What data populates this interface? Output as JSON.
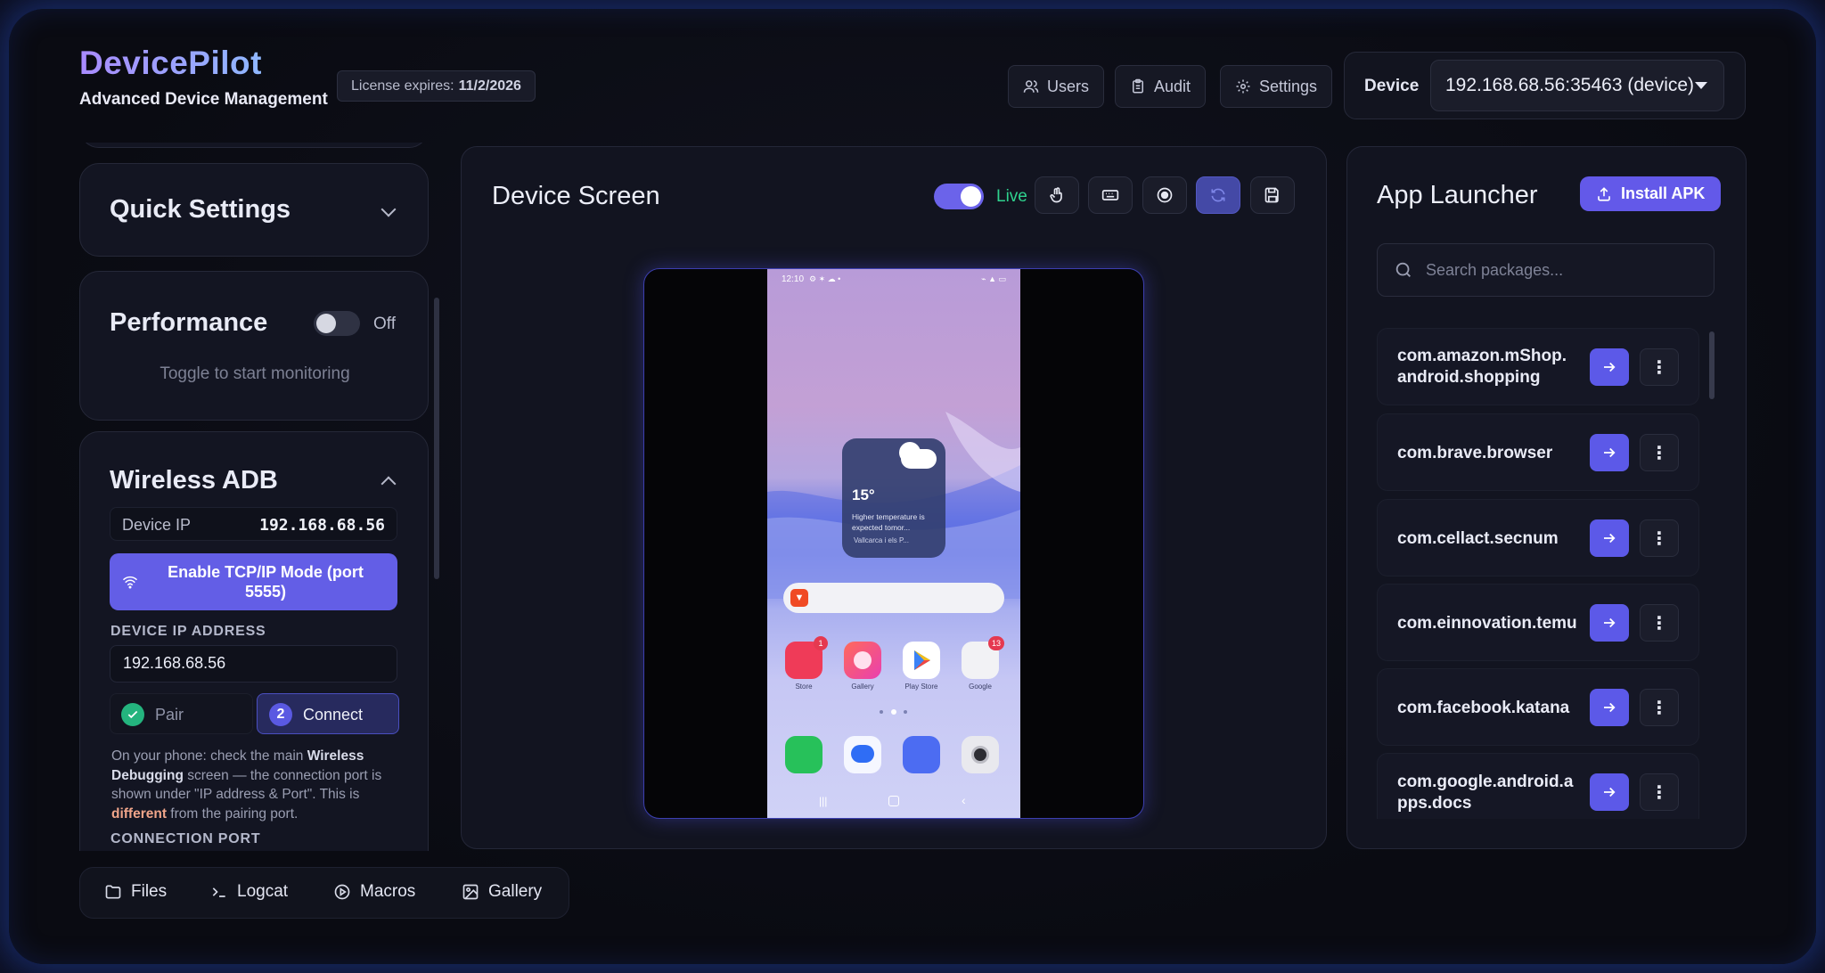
{
  "brand": {
    "title": "DevicePilot",
    "subtitle": "Advanced Device Management"
  },
  "license": {
    "label": "License expires:",
    "date": "11/2/2026"
  },
  "header_nav": {
    "users": "Users",
    "audit": "Audit",
    "settings": "Settings"
  },
  "device": {
    "label": "Device",
    "selected": "192.168.68.56:35463 (device)"
  },
  "quick_settings": {
    "title": "Quick Settings"
  },
  "performance": {
    "title": "Performance",
    "toggle_state": "Off",
    "hint": "Toggle to start monitoring"
  },
  "wireless_adb": {
    "title": "Wireless ADB",
    "device_ip_label": "Device IP",
    "device_ip_value": "192.168.68.56",
    "enable_button": "Enable TCP/IP Mode (port 5555)",
    "ip_address_heading": "DEVICE IP ADDRESS",
    "ip_address_value": "192.168.68.56",
    "step1_label": "Pair",
    "step2_number": "2",
    "step2_label": "Connect",
    "help_p1": "On your phone: check the main ",
    "help_b1": "Wireless Debugging",
    "help_p2": " screen — the connection port is shown under \"IP address & Port\". This is ",
    "help_b2": "different",
    "help_p3": " from the pairing port.",
    "connection_port_heading": "CONNECTION PORT"
  },
  "device_screen": {
    "title": "Device Screen",
    "live_label": "Live"
  },
  "phone": {
    "status_time": "12:10",
    "weather_temp": "15°",
    "weather_text": "Higher temperature is expected tomor...",
    "weather_location": "Vallcarca i els P...",
    "apps_row1": [
      {
        "label": "Store",
        "badge": "1",
        "color": "#ef3b58"
      },
      {
        "label": "Gallery",
        "badge": "",
        "color": "#f5469a"
      },
      {
        "label": "Play Store",
        "badge": "",
        "color": "#ffffff"
      },
      {
        "label": "Google",
        "badge": "13",
        "color": "#f2f2f5"
      }
    ]
  },
  "app_launcher": {
    "title": "App Launcher",
    "install_button": "Install APK",
    "search_placeholder": "Search packages...",
    "packages": [
      {
        "name": "com.amazon.mShop.android.shopping"
      },
      {
        "name": "com.brave.browser"
      },
      {
        "name": "com.cellact.secnum"
      },
      {
        "name": "com.einnovation.temu"
      },
      {
        "name": "com.facebook.katana"
      },
      {
        "name": "com.google.android.apps.docs"
      }
    ]
  },
  "bottom_tabs": {
    "files": "Files",
    "logcat": "Logcat",
    "macros": "Macros",
    "gallery": "Gallery"
  },
  "colors": {
    "accent": "#6359e9",
    "live": "#2fd28e",
    "background": "#0b0d1c"
  }
}
